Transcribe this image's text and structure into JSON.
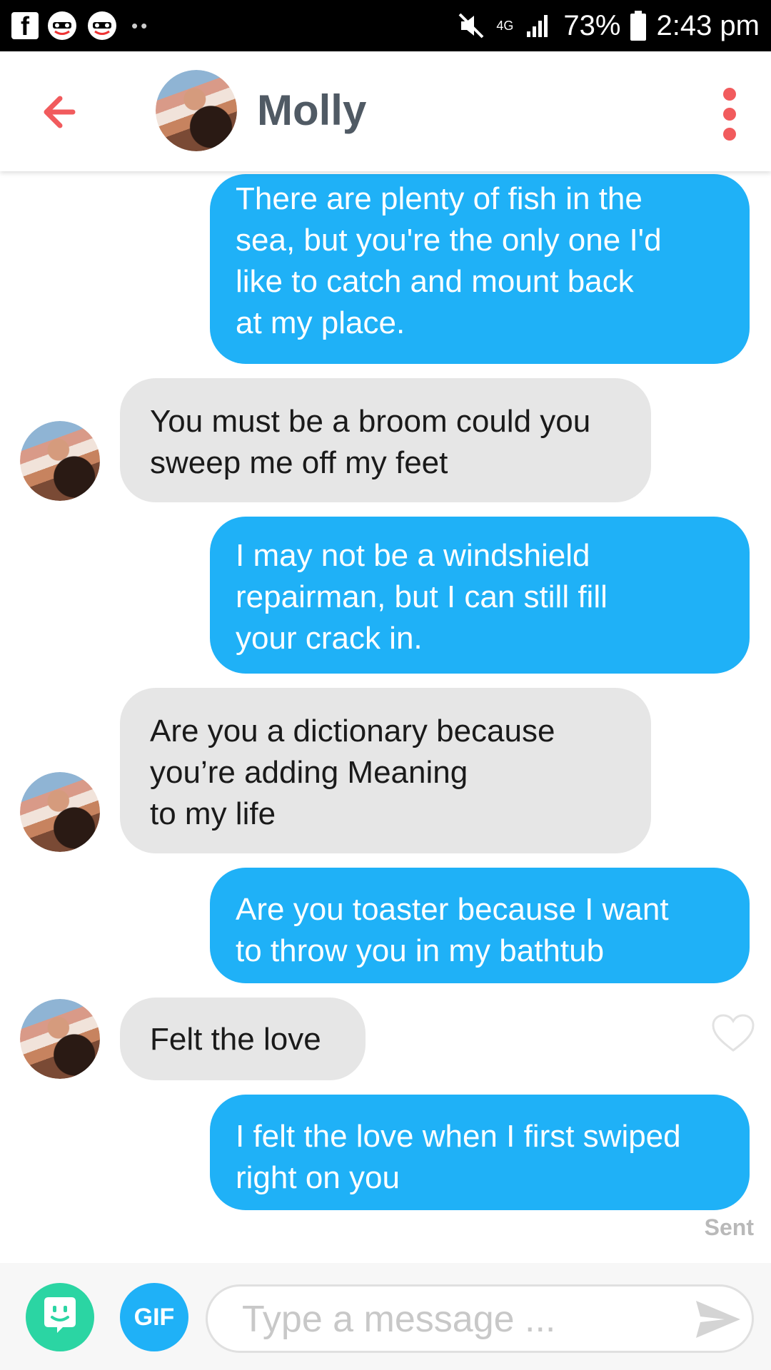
{
  "status_bar": {
    "network_type": "4G",
    "battery": "73%",
    "time": "2:43 pm",
    "icons": [
      "facebook-icon",
      "app-icon",
      "app-icon",
      "more-dots-icon",
      "mute-icon",
      "signal-icon",
      "battery-icon"
    ]
  },
  "header": {
    "name": "Molly",
    "back_icon": "arrow-left-icon",
    "menu_icon": "more-vertical-icon"
  },
  "colors": {
    "accent": "#f15b5d",
    "outgoing_bubble": "#1fb1f7",
    "incoming_bubble": "#e6e6e6",
    "sticker_button": "#2bd5a3"
  },
  "messages": [
    {
      "direction": "outgoing",
      "text": "There are plenty of fish in the\nsea, but you're the only one I'd\nlike to catch and mount back\nat my place."
    },
    {
      "direction": "incoming",
      "text": "You must be a broom could you\nsweep me off my feet"
    },
    {
      "direction": "outgoing",
      "text": "I may not be a windshield\nrepairman, but I can still fill\nyour crack in."
    },
    {
      "direction": "incoming",
      "text": "Are you a dictionary because\nyou’re adding Meaning\nto my life"
    },
    {
      "direction": "outgoing",
      "text": "Are you toaster because I want\nto throw you in my bathtub"
    },
    {
      "direction": "incoming",
      "text": "Felt the love",
      "liked": false
    },
    {
      "direction": "outgoing",
      "text": "I felt the love when I first swiped\nright on you"
    }
  ],
  "sent_label": "Sent",
  "composer": {
    "gif_label": "GIF",
    "placeholder": "Type a message ...",
    "send_icon": "send-icon",
    "sticker_icon": "sticker-icon"
  }
}
